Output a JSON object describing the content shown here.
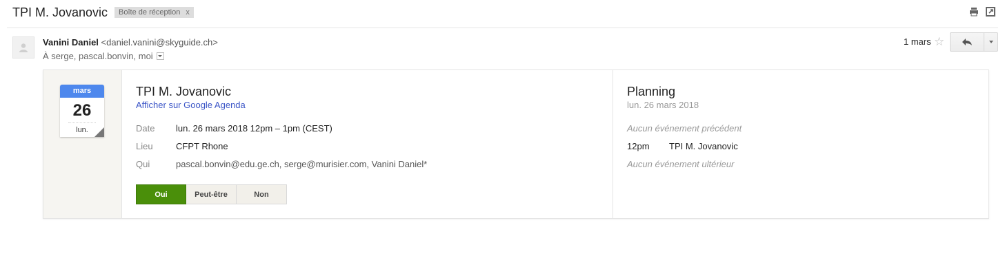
{
  "thread": {
    "subject": "TPI M. Jovanovic",
    "label": "Boîte de réception",
    "label_remove": "x",
    "icons": [
      "print-icon",
      "open-in-new-window-icon"
    ]
  },
  "message": {
    "sender_name": "Vanini Daniel",
    "sender_email": "<daniel.vanini@skyguide.ch>",
    "recipients": "À serge, pascal.bonvin, moi",
    "date": "1 mars",
    "star": "☆"
  },
  "invite": {
    "calendar": {
      "month": "mars",
      "day": "26",
      "weekday": "lun."
    },
    "title": "TPI M. Jovanovic",
    "link": "Afficher sur Google Agenda",
    "details": [
      {
        "key": "Date",
        "value": "lun. 26 mars 2018 12pm – 1pm (CEST)"
      },
      {
        "key": "Lieu",
        "value": "CFPT Rhone"
      },
      {
        "key": "Qui",
        "value": "pascal.bonvin@edu.ge.ch, serge@murisier.com, Vanini Daniel*"
      }
    ],
    "rsvp": {
      "yes": "Oui",
      "maybe": "Peut-être",
      "no": "Non"
    },
    "planning": {
      "title": "Planning",
      "date": "lun. 26 mars 2018",
      "none_before": "Aucun événement précédent",
      "event_time": "12pm",
      "event_name": "TPI M. Jovanovic",
      "none_after": "Aucun événement ultérieur"
    }
  },
  "colors": {
    "calendar_header": "#4e88ed",
    "yes_button": "#4a8f0a",
    "link": "#3b55c7"
  }
}
